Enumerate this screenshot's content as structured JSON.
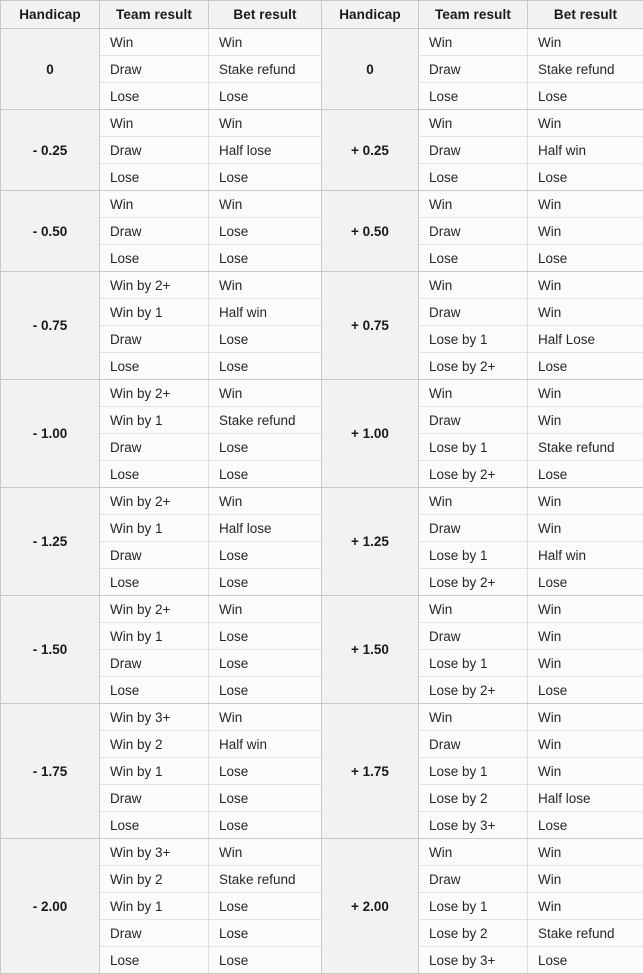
{
  "table": {
    "headers": [
      "Handicap",
      "Team result",
      "Bet result",
      "Handicap",
      "Team result",
      "Bet result"
    ],
    "groups": [
      {
        "left_handicap": "0",
        "right_handicap": "0",
        "rows": [
          {
            "team_left": "Win",
            "bet_left": "Win",
            "team_right": "Win",
            "bet_right": "Win"
          },
          {
            "team_left": "Draw",
            "bet_left": "Stake refund",
            "team_right": "Draw",
            "bet_right": "Stake refund"
          },
          {
            "team_left": "Lose",
            "bet_left": "Lose",
            "team_right": "Lose",
            "bet_right": "Lose"
          }
        ]
      },
      {
        "left_handicap": "- 0.25",
        "right_handicap": "+ 0.25",
        "rows": [
          {
            "team_left": "Win",
            "bet_left": "Win",
            "team_right": "Win",
            "bet_right": "Win"
          },
          {
            "team_left": "Draw",
            "bet_left": "Half lose",
            "team_right": "Draw",
            "bet_right": "Half win"
          },
          {
            "team_left": "Lose",
            "bet_left": "Lose",
            "team_right": "Lose",
            "bet_right": "Lose"
          }
        ]
      },
      {
        "left_handicap": "- 0.50",
        "right_handicap": "+ 0.50",
        "rows": [
          {
            "team_left": "Win",
            "bet_left": "Win",
            "team_right": "Win",
            "bet_right": "Win"
          },
          {
            "team_left": "Draw",
            "bet_left": "Lose",
            "team_right": "Draw",
            "bet_right": "Win"
          },
          {
            "team_left": "Lose",
            "bet_left": "Lose",
            "team_right": "Lose",
            "bet_right": "Lose"
          }
        ]
      },
      {
        "left_handicap": "- 0.75",
        "right_handicap": "+ 0.75",
        "rows": [
          {
            "team_left": "Win by 2+",
            "bet_left": "Win",
            "team_right": "Win",
            "bet_right": "Win"
          },
          {
            "team_left": "Win by 1",
            "bet_left": "Half win",
            "team_right": "Draw",
            "bet_right": "Win"
          },
          {
            "team_left": "Draw",
            "bet_left": "Lose",
            "team_right": "Lose by 1",
            "bet_right": "Half Lose"
          },
          {
            "team_left": "Lose",
            "bet_left": "Lose",
            "team_right": "Lose by 2+",
            "bet_right": "Lose"
          }
        ]
      },
      {
        "left_handicap": "- 1.00",
        "right_handicap": "+ 1.00",
        "rows": [
          {
            "team_left": "Win by 2+",
            "bet_left": "Win",
            "team_right": "Win",
            "bet_right": "Win"
          },
          {
            "team_left": "Win by 1",
            "bet_left": "Stake refund",
            "team_right": "Draw",
            "bet_right": "Win"
          },
          {
            "team_left": "Draw",
            "bet_left": "Lose",
            "team_right": "Lose by 1",
            "bet_right": "Stake refund"
          },
          {
            "team_left": "Lose",
            "bet_left": "Lose",
            "team_right": "Lose by 2+",
            "bet_right": "Lose"
          }
        ]
      },
      {
        "left_handicap": "- 1.25",
        "right_handicap": "+ 1.25",
        "rows": [
          {
            "team_left": "Win by 2+",
            "bet_left": "Win",
            "team_right": "Win",
            "bet_right": "Win"
          },
          {
            "team_left": "Win by 1",
            "bet_left": "Half lose",
            "team_right": "Draw",
            "bet_right": "Win"
          },
          {
            "team_left": "Draw",
            "bet_left": "Lose",
            "team_right": "Lose by 1",
            "bet_right": "Half win"
          },
          {
            "team_left": "Lose",
            "bet_left": "Lose",
            "team_right": "Lose by 2+",
            "bet_right": "Lose"
          }
        ]
      },
      {
        "left_handicap": "- 1.50",
        "right_handicap": "+ 1.50",
        "rows": [
          {
            "team_left": "Win by 2+",
            "bet_left": "Win",
            "team_right": "Win",
            "bet_right": "Win"
          },
          {
            "team_left": "Win by 1",
            "bet_left": "Lose",
            "team_right": "Draw",
            "bet_right": "Win"
          },
          {
            "team_left": "Draw",
            "bet_left": "Lose",
            "team_right": "Lose by 1",
            "bet_right": "Win"
          },
          {
            "team_left": "Lose",
            "bet_left": "Lose",
            "team_right": "Lose by 2+",
            "bet_right": "Lose"
          }
        ]
      },
      {
        "left_handicap": "- 1.75",
        "right_handicap": "+ 1.75",
        "rows": [
          {
            "team_left": "Win by 3+",
            "bet_left": "Win",
            "team_right": "Win",
            "bet_right": "Win"
          },
          {
            "team_left": "Win by 2",
            "bet_left": "Half win",
            "team_right": "Draw",
            "bet_right": "Win"
          },
          {
            "team_left": "Win by 1",
            "bet_left": "Lose",
            "team_right": "Lose by 1",
            "bet_right": "Win"
          },
          {
            "team_left": "Draw",
            "bet_left": "Lose",
            "team_right": "Lose by 2",
            "bet_right": "Half lose"
          },
          {
            "team_left": "Lose",
            "bet_left": "Lose",
            "team_right": "Lose by 3+",
            "bet_right": "Lose"
          }
        ]
      },
      {
        "left_handicap": "- 2.00",
        "right_handicap": "+ 2.00",
        "rows": [
          {
            "team_left": "Win by 3+",
            "bet_left": "Win",
            "team_right": "Win",
            "bet_right": "Win"
          },
          {
            "team_left": "Win by 2",
            "bet_left": "Stake refund",
            "team_right": "Draw",
            "bet_right": "Win"
          },
          {
            "team_left": "Win by 1",
            "bet_left": "Lose",
            "team_right": "Lose by 1",
            "bet_right": "Win"
          },
          {
            "team_left": "Draw",
            "bet_left": "Lose",
            "team_right": "Lose by 2",
            "bet_right": "Stake refund"
          },
          {
            "team_left": "Lose",
            "bet_left": "Lose",
            "team_right": "Lose by 3+",
            "bet_right": "Lose"
          }
        ]
      }
    ]
  },
  "colors": {
    "header_background": "#f2f2f2",
    "handicap_background": "#f2f2f2",
    "cell_background": "#fbfbfb",
    "outer_border": "#c9c9c9",
    "inner_border": "#e2e2e2",
    "text": "#262626"
  }
}
